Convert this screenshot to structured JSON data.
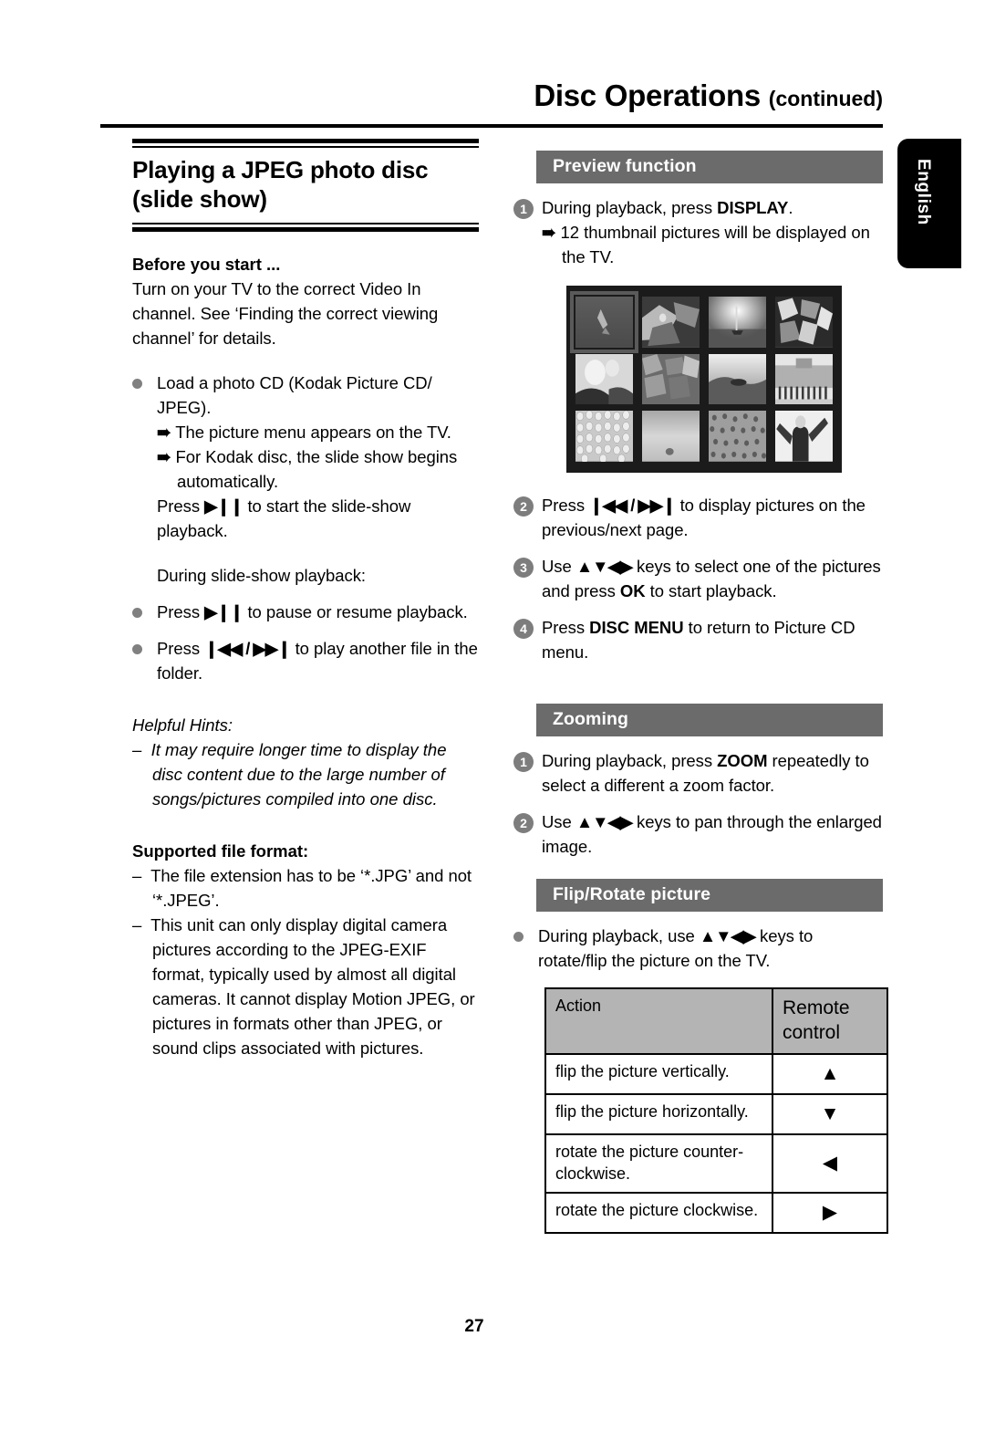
{
  "header": {
    "title": "Disc Operations",
    "continued": "(continued)"
  },
  "language_tab": {
    "label": "English"
  },
  "page_number": "27",
  "left_column": {
    "section_title": "Playing a JPEG photo disc (slide show)",
    "before_you_start": {
      "heading": "Before you start ...",
      "text": "Turn on your TV to the correct Video In channel. See ‘Finding the correct viewing channel’ for details."
    },
    "load_bullet": {
      "text": "Load a photo CD (Kodak Picture CD/ JPEG).",
      "arrows": [
        "The picture menu appears on the TV.",
        "For Kodak disc, the slide show begins automatically."
      ],
      "press_prefix": "Press",
      "press_glyph": "play-pause-icon",
      "press_suffix": "to start the slide-show playback."
    },
    "during_label": "During slide-show playback:",
    "bullets": [
      {
        "prefix": "Press",
        "glyph": "play-pause-icon",
        "suffix": "to pause or resume playback."
      },
      {
        "prefix": "Press",
        "glyph": "prev-next-icon",
        "suffix": "to play another file in the folder."
      }
    ],
    "helpful_hints": {
      "heading": "Helpful Hints:",
      "items": [
        "It may require longer time to display the disc content due to the large number of songs/pictures compiled into one disc."
      ]
    },
    "supported_file_format": {
      "heading": "Supported file format:",
      "items": [
        "The file extension has to be ‘*.JPG’ and not ‘*.JPEG’.",
        "This unit can only display digital camera pictures according to the JPEG-EXIF format, typically used by almost all digital cameras. It cannot display Motion JPEG, or pictures in formats other than JPEG, or sound clips associated with pictures."
      ]
    }
  },
  "right_column": {
    "preview": {
      "band": "Preview function",
      "steps": [
        {
          "num": "1",
          "text": "During playback, press DISPLAY.",
          "text_plain": "During playback, press ",
          "bold": "DISPLAY",
          "tail": ".",
          "arrow": "12 thumbnail pictures will be displayed on the TV."
        }
      ],
      "tv_screen": {
        "thumbnail_count": 12,
        "columns": 4,
        "rows": 3,
        "selected_index": 0
      },
      "steps_after": [
        {
          "num": "2",
          "prefix": "Press",
          "glyph": "prev-next-icon",
          "suffix": "to display pictures on the previous/next page."
        },
        {
          "num": "3",
          "prefix": "Use",
          "glyph": "dpad-arrows-icon",
          "mid": "keys to select one of the pictures and press ",
          "bold": "OK",
          "tail": " to start playback."
        },
        {
          "num": "4",
          "prefix": "Press ",
          "bold": "DISC MENU",
          "tail": " to return to Picture CD menu."
        }
      ]
    },
    "zooming": {
      "band": "Zooming",
      "steps": [
        {
          "num": "1",
          "prefix": "During playback, press ",
          "bold": "ZOOM",
          "tail": " repeatedly to select a different a zoom factor."
        },
        {
          "num": "2",
          "prefix": "Use",
          "glyph": "dpad-arrows-icon",
          "suffix": "keys to pan through the enlarged image."
        }
      ]
    },
    "flip_rotate": {
      "band": "Flip/Rotate picture",
      "bullet": {
        "prefix": "During playback, use",
        "glyph": "dpad-arrows-icon",
        "suffix": "keys to rotate/flip the picture on the TV."
      },
      "table": {
        "headers": [
          "Action",
          "Remote control"
        ],
        "rows": [
          {
            "action": "flip the picture vertically.",
            "key": "▲",
            "key_name": "up-arrow-icon"
          },
          {
            "action": "flip the picture horizontally.",
            "key": "▼",
            "key_name": "down-arrow-icon"
          },
          {
            "action": "rotate the picture counter-clockwise.",
            "key": "◀",
            "key_name": "left-arrow-icon"
          },
          {
            "action": "rotate the picture clockwise.",
            "key": "▶",
            "key_name": "right-arrow-icon"
          }
        ]
      }
    }
  },
  "colors": {
    "band_gray": "#6b6b6b",
    "step_circle_gray": "#7d7d7d",
    "bullet_gray": "#808080",
    "table_header_gray": "#b4b4b4",
    "tv_background": "#1b1b1b"
  }
}
